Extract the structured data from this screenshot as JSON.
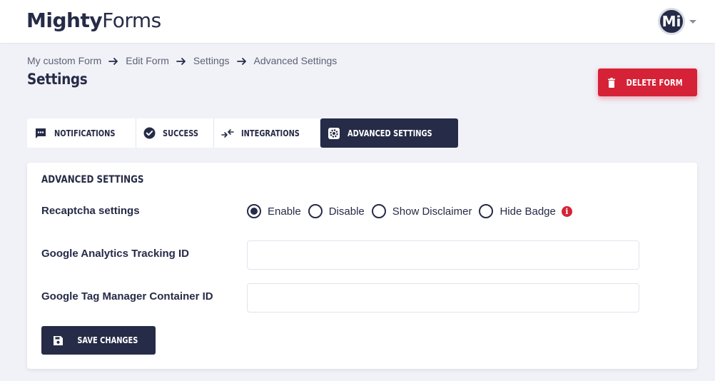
{
  "header": {
    "logo_m": "M",
    "logo_ighty": "ighty",
    "logo_forms": "Forms",
    "avatar_initials": "Mi"
  },
  "breadcrumb": {
    "items": [
      "My custom Form",
      "Edit Form",
      "Settings",
      "Advanced Settings"
    ]
  },
  "page": {
    "title": "Settings",
    "delete_label": "DELETE FORM"
  },
  "tabs": [
    {
      "label": "NOTIFICATIONS",
      "icon": "chat-icon",
      "active": false
    },
    {
      "label": "SUCCESS",
      "icon": "check-circle-icon",
      "active": false
    },
    {
      "label": "INTEGRATIONS",
      "icon": "swap-arrows-icon",
      "active": false
    },
    {
      "label": "ADVANCED SETTINGS",
      "icon": "gear-icon",
      "active": true
    }
  ],
  "advanced": {
    "section_title": "ADVANCED SETTINGS",
    "recaptcha_label": "Recaptcha settings",
    "recaptcha_options": [
      "Enable",
      "Disable",
      "Show Disclaimer",
      "Hide Badge"
    ],
    "recaptcha_selected": "Enable",
    "info_glyph": "i",
    "ga_label": "Google Analytics Tracking ID",
    "ga_value": "",
    "gtm_label": "Google Tag Manager Container ID",
    "gtm_value": "",
    "save_label": "SAVE CHANGES"
  },
  "colors": {
    "primary": "#262b47",
    "danger": "#d62237",
    "background": "#f1f2f7"
  }
}
